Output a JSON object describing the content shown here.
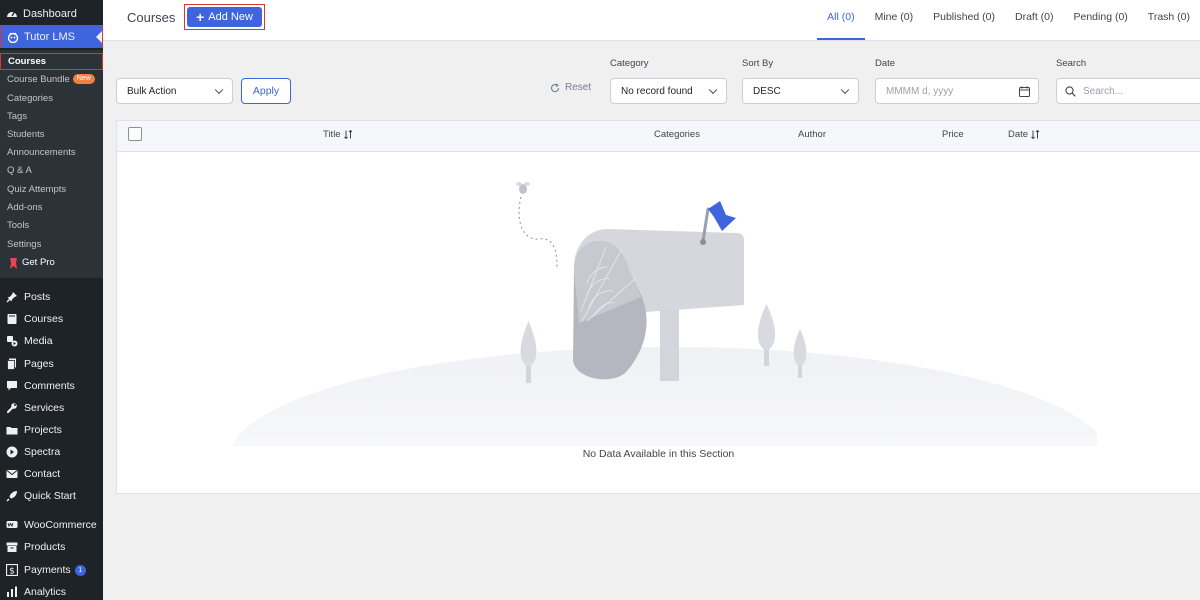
{
  "sidebar": {
    "dashboard": "Dashboard",
    "tutor": "Tutor LMS",
    "submenu": [
      "Courses",
      "Course Bundle",
      "Categories",
      "Tags",
      "Students",
      "Announcements",
      "Q & A",
      "Quiz Attempts",
      "Add-ons",
      "Tools",
      "Settings",
      "Get Pro"
    ],
    "new_badge": "New",
    "menu": [
      "Posts",
      "Courses",
      "Media",
      "Pages",
      "Comments",
      "Services",
      "Projects",
      "Spectra",
      "Contact",
      "Quick Start",
      "WooCommerce",
      "Products",
      "Payments",
      "Analytics"
    ],
    "payments_count": "1"
  },
  "header": {
    "title": "Courses",
    "add_new": "Add New",
    "tabs": [
      "All (0)",
      "Mine (0)",
      "Published (0)",
      "Draft (0)",
      "Pending (0)",
      "Trash (0)"
    ]
  },
  "filters": {
    "bulk_action": "Bulk Action",
    "apply": "Apply",
    "reset": "Reset",
    "category_label": "Category",
    "category_value": "No record found",
    "sort_label": "Sort By",
    "sort_value": "DESC",
    "date_label": "Date",
    "date_placeholder": "MMMM d, yyyy",
    "search_label": "Search",
    "search_placeholder": "Search..."
  },
  "table": {
    "columns": [
      "Title",
      "Categories",
      "Author",
      "Price",
      "Date"
    ],
    "empty_message": "No Data Available in this Section"
  },
  "colors": {
    "primary": "#3e64de",
    "sidebar": "#1d2327",
    "highlight": "#d63638"
  }
}
